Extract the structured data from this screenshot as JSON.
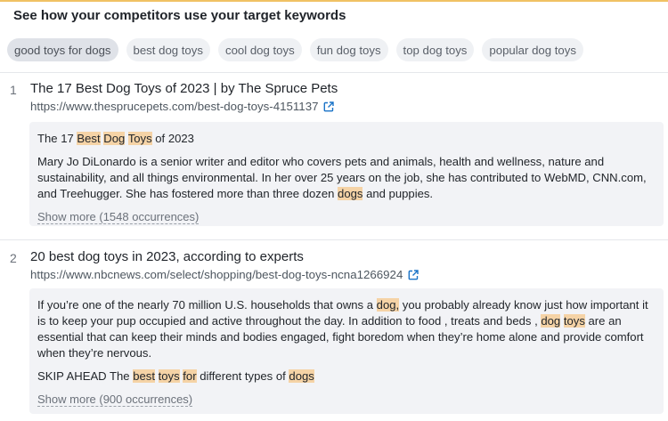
{
  "header": {
    "title": "See how your competitors use your target keywords"
  },
  "keywords": [
    "good toys for dogs",
    "best dog toys",
    "cool dog toys",
    "fun dog toys",
    "top dog toys",
    "popular dog toys"
  ],
  "colors": {
    "accent_line": "#f0c264",
    "highlight": "#f5d3a6",
    "link_icon": "#1a73c7"
  },
  "results": [
    {
      "rank": "1",
      "title": "The 17 Best Dog Toys of 2023 | by The Spruce Pets",
      "url": "https://www.thesprucepets.com/best-dog-toys-4151137",
      "link_icon": "external-link-icon",
      "p1": {
        "t0": "The 17 ",
        "h1": "Best",
        "t1": " ",
        "h2": "Dog",
        "t2": " ",
        "h3": "Toys",
        "t3": " of 2023"
      },
      "p2": {
        "t0": "Mary Jo DiLonardo is a senior writer and editor who covers pets and animals, health and wellness, nature and sustainability, and all things environmental. In her over 25 years on the job, she has contributed to WebMD, CNN.com, and Treehugger. She has fostered more than three dozen ",
        "h1": "dogs",
        "t1": " and puppies."
      },
      "show_more": "Show more (1548 occurrences)"
    },
    {
      "rank": "2",
      "title": "20 best dog toys in 2023, according to experts",
      "url": "https://www.nbcnews.com/select/shopping/best-dog-toys-ncna1266924",
      "link_icon": "external-link-icon",
      "p1": {
        "t0": "If you’re one of the nearly 70 million U.S. households that owns a ",
        "h1": "dog,",
        "t1": " you probably already know just how important it is to keep your pup occupied and active throughout the day. In addition to food , treats and beds , ",
        "h2": "dog",
        "t2": " ",
        "h3": "toys",
        "t3": " are an essential that can keep their minds and bodies engaged, fight boredom when they’re home alone and provide comfort when they’re nervous."
      },
      "p2": {
        "t0": "SKIP AHEAD The ",
        "h1": "best",
        "t1": " ",
        "h2": "toys",
        "t2": " ",
        "h3": "for",
        "t3": " different types of ",
        "h4": "dogs"
      },
      "show_more": "Show more (900 occurrences)"
    }
  ]
}
